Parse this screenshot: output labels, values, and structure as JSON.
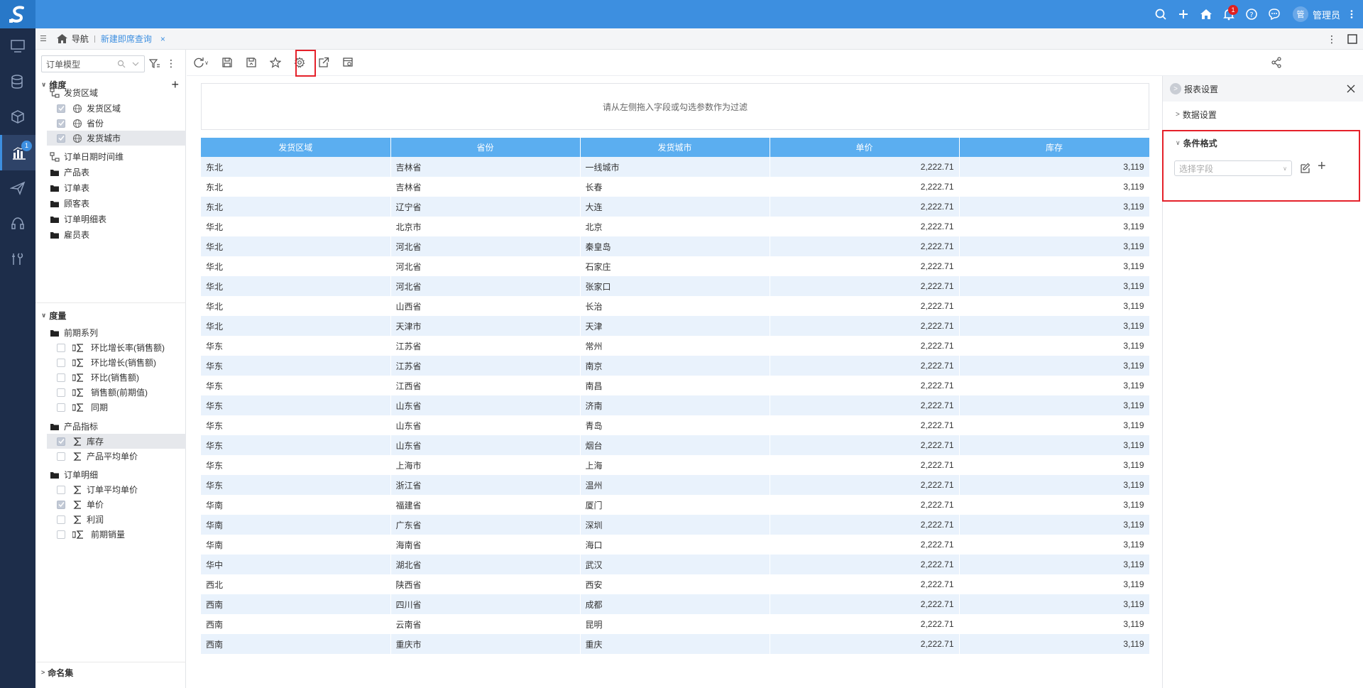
{
  "header": {
    "user_avatar": "管",
    "user_name": "管理员",
    "notification_count": "1"
  },
  "left_nav": {
    "badge": "1"
  },
  "tabs": {
    "home_label": "导航",
    "active_tab": "新建即席查询",
    "close": "×"
  },
  "panel": {
    "model_placeholder": "订单模型",
    "dimensions_title": "维度",
    "dim_tree": [
      {
        "label": "发货区域",
        "level": 0,
        "type": "hierarchy"
      },
      {
        "label": "发货区域",
        "level": 1,
        "type": "field",
        "checked": true
      },
      {
        "label": "省份",
        "level": 1,
        "type": "field",
        "checked": true
      },
      {
        "label": "发货城市",
        "level": 1,
        "type": "field",
        "checked": true,
        "selected": true
      },
      {
        "label": "订单日期时间维",
        "level": 0,
        "type": "hierarchy"
      },
      {
        "label": "产品表",
        "level": 0,
        "type": "folder"
      },
      {
        "label": "订单表",
        "level": 0,
        "type": "folder"
      },
      {
        "label": "顾客表",
        "level": 0,
        "type": "folder"
      },
      {
        "label": "订单明细表",
        "level": 0,
        "type": "folder"
      },
      {
        "label": "雇员表",
        "level": 0,
        "type": "folder"
      }
    ],
    "measures_title": "度量",
    "measure_tree": [
      {
        "label": "前期系列",
        "level": 0,
        "type": "folder"
      },
      {
        "label": "环比增长率(销售额)",
        "level": 1,
        "type": "calc",
        "checked": false
      },
      {
        "label": "环比增长(销售额)",
        "level": 1,
        "type": "calc",
        "checked": false
      },
      {
        "label": "环比(销售额)",
        "level": 1,
        "type": "calc",
        "checked": false
      },
      {
        "label": "销售额(前期值)",
        "level": 1,
        "type": "calc",
        "checked": false
      },
      {
        "label": "同期",
        "level": 1,
        "type": "calc",
        "checked": false
      },
      {
        "label": "产品指标",
        "level": 0,
        "type": "folder"
      },
      {
        "label": "库存",
        "level": 1,
        "type": "sum",
        "checked": true,
        "selected": true
      },
      {
        "label": "产品平均单价",
        "level": 1,
        "type": "sum",
        "checked": false
      },
      {
        "label": "订单明细",
        "level": 0,
        "type": "folder"
      },
      {
        "label": "订单平均单价",
        "level": 1,
        "type": "sum",
        "checked": false
      },
      {
        "label": "单价",
        "level": 1,
        "type": "sum",
        "checked": true
      },
      {
        "label": "利润",
        "level": 1,
        "type": "sum",
        "checked": false
      },
      {
        "label": "前期销量",
        "level": 1,
        "type": "calc",
        "checked": false
      }
    ],
    "named_sets_title": "命名集"
  },
  "filter_hint": "请从左侧拖入字段或勾选参数作为过滤",
  "table": {
    "columns": [
      "发货区域",
      "省份",
      "发货城市",
      "单价",
      "库存"
    ],
    "rows": [
      [
        "东北",
        "吉林省",
        "一线城市",
        "2,222.71",
        "3,119"
      ],
      [
        "东北",
        "吉林省",
        "长春",
        "2,222.71",
        "3,119"
      ],
      [
        "东北",
        "辽宁省",
        "大连",
        "2,222.71",
        "3,119"
      ],
      [
        "华北",
        "北京市",
        "北京",
        "2,222.71",
        "3,119"
      ],
      [
        "华北",
        "河北省",
        "秦皇岛",
        "2,222.71",
        "3,119"
      ],
      [
        "华北",
        "河北省",
        "石家庄",
        "2,222.71",
        "3,119"
      ],
      [
        "华北",
        "河北省",
        "张家口",
        "2,222.71",
        "3,119"
      ],
      [
        "华北",
        "山西省",
        "长治",
        "2,222.71",
        "3,119"
      ],
      [
        "华北",
        "天津市",
        "天津",
        "2,222.71",
        "3,119"
      ],
      [
        "华东",
        "江苏省",
        "常州",
        "2,222.71",
        "3,119"
      ],
      [
        "华东",
        "江苏省",
        "南京",
        "2,222.71",
        "3,119"
      ],
      [
        "华东",
        "江西省",
        "南昌",
        "2,222.71",
        "3,119"
      ],
      [
        "华东",
        "山东省",
        "济南",
        "2,222.71",
        "3,119"
      ],
      [
        "华东",
        "山东省",
        "青岛",
        "2,222.71",
        "3,119"
      ],
      [
        "华东",
        "山东省",
        "烟台",
        "2,222.71",
        "3,119"
      ],
      [
        "华东",
        "上海市",
        "上海",
        "2,222.71",
        "3,119"
      ],
      [
        "华东",
        "浙江省",
        "温州",
        "2,222.71",
        "3,119"
      ],
      [
        "华南",
        "福建省",
        "厦门",
        "2,222.71",
        "3,119"
      ],
      [
        "华南",
        "广东省",
        "深圳",
        "2,222.71",
        "3,119"
      ],
      [
        "华南",
        "海南省",
        "海口",
        "2,222.71",
        "3,119"
      ],
      [
        "华中",
        "湖北省",
        "武汉",
        "2,222.71",
        "3,119"
      ],
      [
        "西北",
        "陕西省",
        "西安",
        "2,222.71",
        "3,119"
      ],
      [
        "西南",
        "四川省",
        "成都",
        "2,222.71",
        "3,119"
      ],
      [
        "西南",
        "云南省",
        "昆明",
        "2,222.71",
        "3,119"
      ],
      [
        "西南",
        "重庆市",
        "重庆",
        "2,222.71",
        "3,119"
      ]
    ]
  },
  "right_panel": {
    "title": "报表设置",
    "data_settings": "数据设置",
    "conditional_format": "条件格式",
    "field_placeholder": "选择字段"
  },
  "colors": {
    "topbar": "#3d8fe0",
    "nav": "#1d2d4a",
    "table_header": "#5baef0",
    "highlight": "#e5212a"
  }
}
